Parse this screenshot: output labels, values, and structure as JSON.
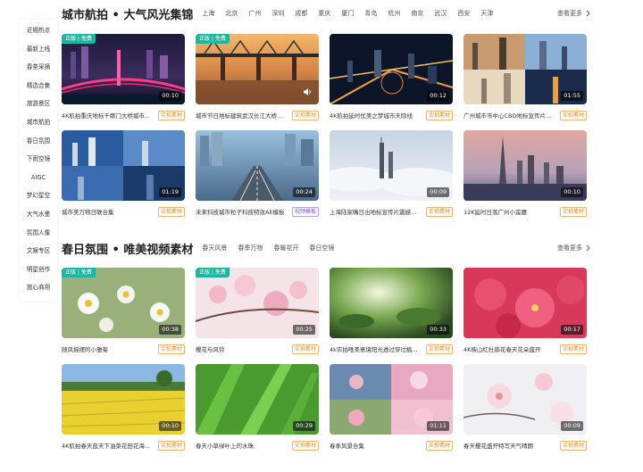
{
  "sidebar": {
    "items": [
      "近期热点",
      "最新上线",
      "春茶采摘",
      "精选合集",
      "旅游景区",
      "城市航拍",
      "春日氛围",
      "下雨空镜",
      "AIGC",
      "梦幻星空",
      "大气水墨",
      "氛围人像",
      "文娱专区",
      "明星创作",
      "放心商用"
    ]
  },
  "section1": {
    "title": "城市航拍 • 大气风光集锦",
    "tabs": [
      "上海",
      "北京",
      "广州",
      "深圳",
      "成都",
      "重庆",
      "厦门",
      "青岛",
      "杭州",
      "南京",
      "武汉",
      "西安",
      "天津"
    ],
    "more": "查看更多"
  },
  "section2": {
    "title": "春日氛围 • 唯美视频素材",
    "tabs": [
      "春天风景",
      "春季万物",
      "春暖花开",
      "春日空镜"
    ],
    "more": "查看更多"
  },
  "cards1": [
    {
      "title": "4K航拍重庆地标千厮门大桥城市...",
      "duration": "00:10",
      "badge": "正版 | 免费",
      "tag": "实拍素材"
    },
    {
      "title": "城市节日地标建筑武汉长江大桥...",
      "duration": "",
      "badge": "正版 | 免费",
      "tag": "实拍素材"
    },
    {
      "title": "4K航拍延时优美之梦城市天际线",
      "duration": "00:12",
      "badge": "",
      "tag": "实拍素材"
    },
    {
      "title": "广州城市市中心CBD地标宣传片...",
      "duration": "01:55",
      "badge": "",
      "tag": "实拍素材"
    },
    {
      "title": "城市美万物日联合集",
      "duration": "01:19",
      "badge": "",
      "tag": "实拍素材"
    },
    {
      "title": "未来科技城市粒子科技特效AE模板",
      "duration": "00:24",
      "badge": "",
      "tag": "视频模板"
    },
    {
      "title": "上海陆家嘴日出地标宣传片震撼...",
      "duration": "00:09",
      "badge": "",
      "tag": "实拍素材"
    },
    {
      "title": "12K延时日落广州小蛮腰",
      "duration": "00:10",
      "badge": "",
      "tag": "实拍素材"
    }
  ],
  "cards2": [
    {
      "title": "随风摇摆的小雏菊",
      "duration": "00:38",
      "badge": "正版 | 免费",
      "tag": "实拍素材"
    },
    {
      "title": "樱花与风铃",
      "duration": "00:25",
      "badge": "正版 | 免费",
      "tag": "实拍素材"
    },
    {
      "title": "4k实拍唯美意境阳光透过穿过植...",
      "duration": "00:33",
      "badge": "",
      "tag": "实拍素材"
    },
    {
      "title": "4K映山红杜鹃花春天花朵盛开",
      "duration": "00:17",
      "badge": "",
      "tag": "实拍素材"
    },
    {
      "title": "4K航拍春天蓝天下油菜花田花海...",
      "duration": "00:10",
      "badge": "",
      "tag": "实拍素材"
    },
    {
      "title": "春天小草绿叶上的水珠",
      "duration": "00:29",
      "badge": "",
      "tag": "实拍素材"
    },
    {
      "title": "春季风景合集",
      "duration": "01:11",
      "badge": "",
      "tag": "实拍素材"
    },
    {
      "title": "春天樱花盛开特写天气晴朗",
      "duration": "00:09",
      "badge": "",
      "tag": "实拍素材"
    }
  ],
  "colors": {
    "accent": "#1bb7a0",
    "tag_orange": "#f08a1a",
    "tag_purple": "#7a56d8"
  },
  "icons": {
    "more": "chevron-right-icon",
    "volume": "volume-icon"
  }
}
